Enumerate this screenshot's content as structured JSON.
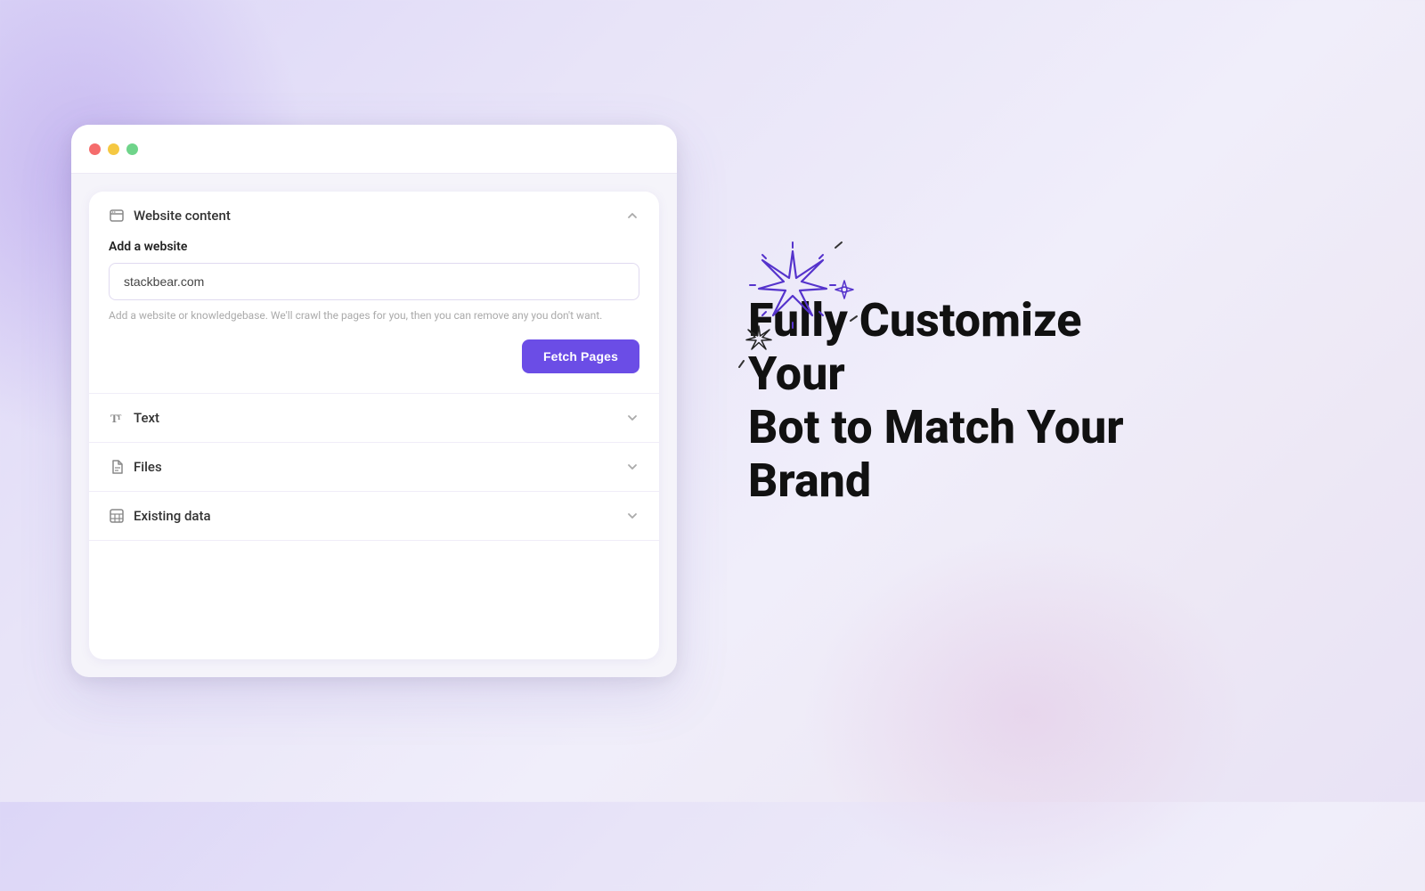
{
  "browser": {
    "dots": [
      "red",
      "yellow",
      "green"
    ]
  },
  "panel": {
    "sections": [
      {
        "id": "website-content",
        "icon": "browser-icon",
        "title": "Website content",
        "expanded": true,
        "field": {
          "label": "Add a website",
          "placeholder": "stackbear.com",
          "hint": "Add a website or knowledgebase. We'll crawl the pages for you, then you can remove any you don't want.",
          "value": "stackbear.com"
        },
        "button": "Fetch Pages"
      },
      {
        "id": "text",
        "icon": "text-icon",
        "title": "Text",
        "expanded": false
      },
      {
        "id": "files",
        "icon": "file-icon",
        "title": "Files",
        "expanded": false
      },
      {
        "id": "existing-data",
        "icon": "table-icon",
        "title": "Existing data",
        "expanded": false
      }
    ]
  },
  "headline": {
    "line1": "Fully Customize Your",
    "line2": "Bot to Match Your Brand"
  },
  "colors": {
    "accent": "#6b4de6",
    "sparkle": "#6b4de6"
  }
}
